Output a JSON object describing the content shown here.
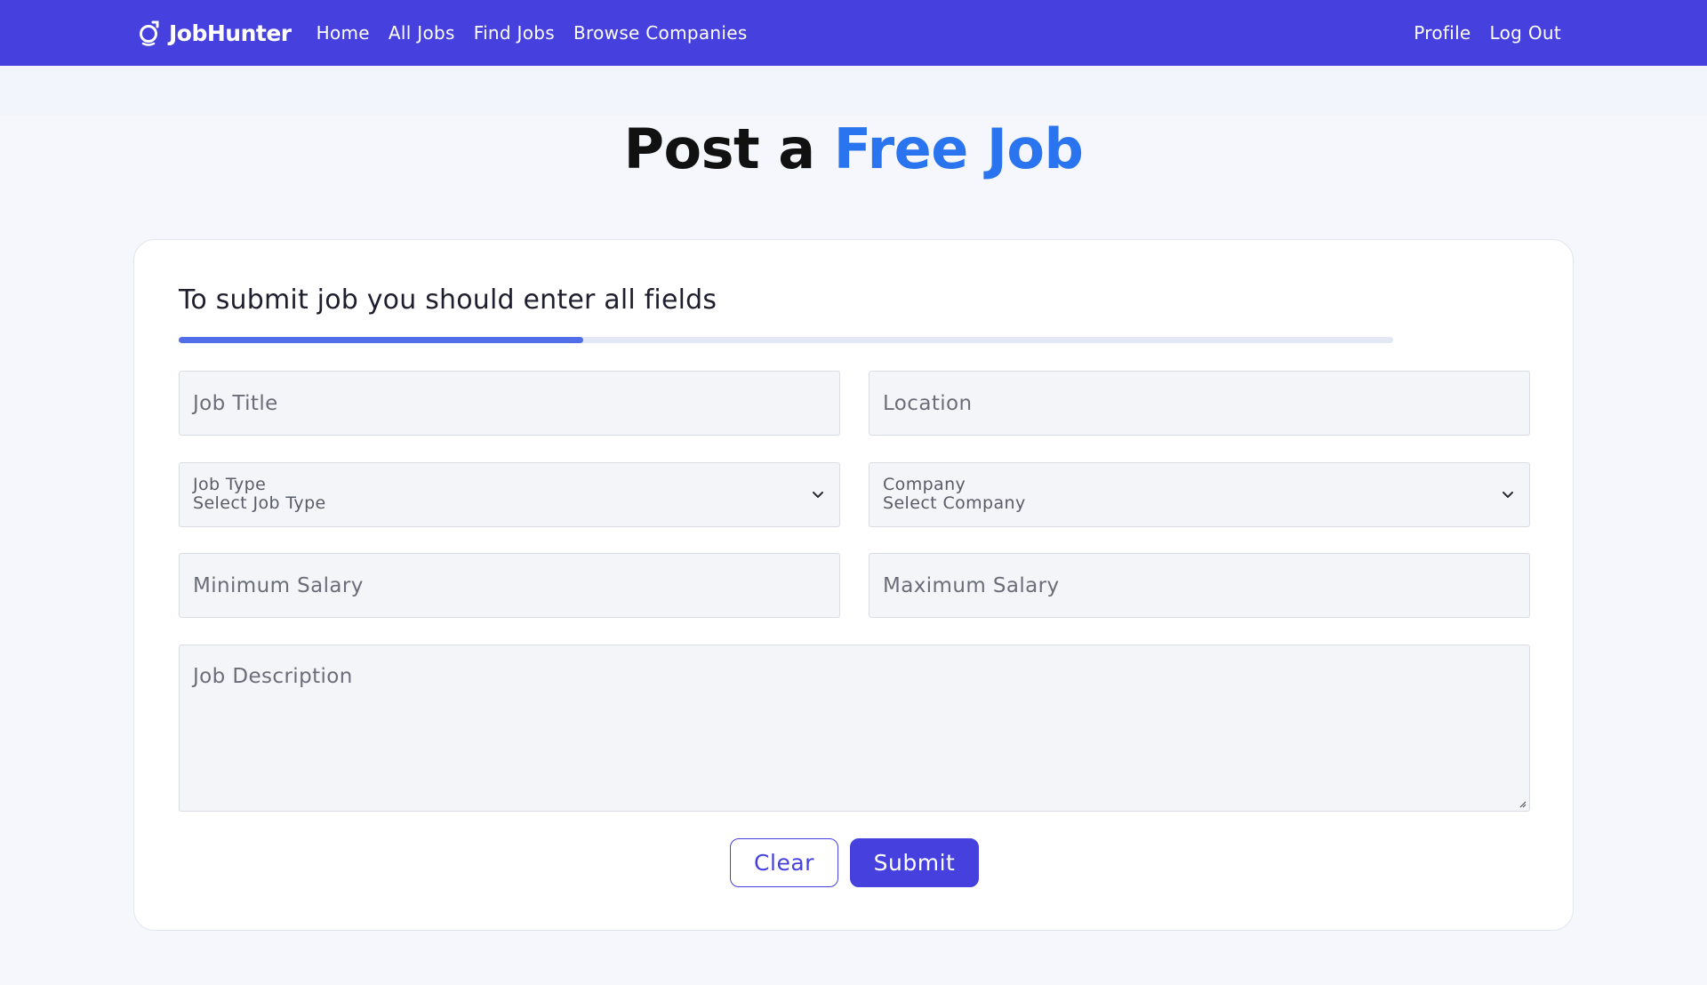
{
  "nav": {
    "brand": "JobHunter",
    "brand_icon": "jobhunter-logo-icon",
    "links": [
      "Home",
      "All Jobs",
      "Find Jobs",
      "Browse Companies"
    ],
    "right_links": [
      "Profile",
      "Log Out"
    ],
    "background_color": "#4640de"
  },
  "hero": {
    "title_prefix": "Post a ",
    "title_accent": "Free Job",
    "accent_color": "#2a74ef"
  },
  "form": {
    "heading": "To submit job you should enter all fields",
    "progress_fraction": 0.333,
    "job_title_placeholder": "Job Title",
    "location_placeholder": "Location",
    "job_type": {
      "label": "Job Type",
      "value": "Select Job Type",
      "icon": "chevron-down-icon"
    },
    "company": {
      "label": "Company",
      "value": "Select Company",
      "icon": "chevron-down-icon"
    },
    "min_salary_placeholder": "Minimum Salary",
    "max_salary_placeholder": "Maximum Salary",
    "description_placeholder": "Job Description",
    "clear_label": "Clear",
    "submit_label": "Submit"
  }
}
